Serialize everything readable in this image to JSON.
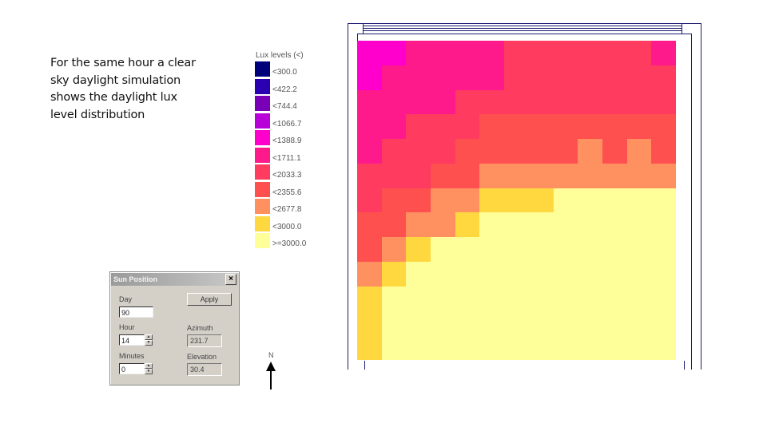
{
  "caption": {
    "lines": [
      "For the same hour a clear",
      "sky daylight simulation",
      "shows the daylight lux",
      "level distribution"
    ]
  },
  "legend": {
    "title": "Lux levels (<)",
    "items": [
      {
        "label": "<300.0",
        "color": "#00007a"
      },
      {
        "label": "<422.2",
        "color": "#2a00b0"
      },
      {
        "label": "<744.4",
        "color": "#7a00b8"
      },
      {
        "label": "<1066.7",
        "color": "#b800d8"
      },
      {
        "label": "<1388.9",
        "color": "#ff00cc"
      },
      {
        "label": "<1711.1",
        "color": "#ff1a8c"
      },
      {
        "label": "<2033.3",
        "color": "#ff3b60"
      },
      {
        "label": "<2355.6",
        "color": "#ff5050"
      },
      {
        "label": "<2677.8",
        "color": "#ff9160"
      },
      {
        "label": "<3000.0",
        "color": "#ffd840"
      },
      {
        "label": ">=3000.0",
        "color": "#ffff99"
      }
    ]
  },
  "lux_grid": {
    "columns": 13,
    "rows": [
      [
        4,
        4,
        5,
        5,
        5,
        5,
        6,
        6,
        6,
        6,
        6,
        6,
        5
      ],
      [
        4,
        5,
        5,
        5,
        5,
        5,
        6,
        6,
        6,
        6,
        6,
        6,
        6
      ],
      [
        5,
        5,
        5,
        5,
        6,
        6,
        6,
        6,
        6,
        6,
        6,
        6,
        6
      ],
      [
        5,
        5,
        6,
        6,
        6,
        7,
        7,
        7,
        7,
        7,
        7,
        7,
        7
      ],
      [
        5,
        6,
        6,
        6,
        7,
        7,
        7,
        7,
        7,
        8,
        7,
        8,
        7
      ],
      [
        6,
        6,
        6,
        7,
        7,
        8,
        8,
        8,
        8,
        8,
        8,
        8,
        8
      ],
      [
        6,
        7,
        7,
        8,
        8,
        9,
        9,
        9,
        10,
        10,
        10,
        10,
        10
      ],
      [
        7,
        7,
        8,
        8,
        9,
        10,
        10,
        10,
        10,
        10,
        10,
        10,
        10
      ],
      [
        7,
        8,
        9,
        10,
        10,
        10,
        10,
        10,
        10,
        10,
        10,
        10,
        10
      ],
      [
        8,
        9,
        10,
        10,
        10,
        10,
        10,
        10,
        10,
        10,
        10,
        10,
        10
      ],
      [
        9,
        10,
        10,
        10,
        10,
        10,
        10,
        10,
        10,
        10,
        10,
        10,
        10
      ],
      [
        9,
        10,
        10,
        10,
        10,
        10,
        10,
        10,
        10,
        10,
        10,
        10,
        10
      ],
      [
        9,
        10,
        10,
        10,
        10,
        10,
        10,
        10,
        10,
        10,
        10,
        10,
        10
      ]
    ]
  },
  "compass": {
    "label": "N"
  },
  "dialog": {
    "title": "Sun Position",
    "close_glyph": "×",
    "day_label": "Day",
    "day_value": "90",
    "hour_label": "Hour",
    "hour_value": "14",
    "minutes_label": "Minutes",
    "minutes_value": "0",
    "apply_label": "Apply",
    "azimuth_label": "Azimuth",
    "azimuth_value": "231.7",
    "elevation_label": "Elevation",
    "elevation_value": "30.4",
    "spin_up": "▲",
    "spin_down": "▼"
  }
}
